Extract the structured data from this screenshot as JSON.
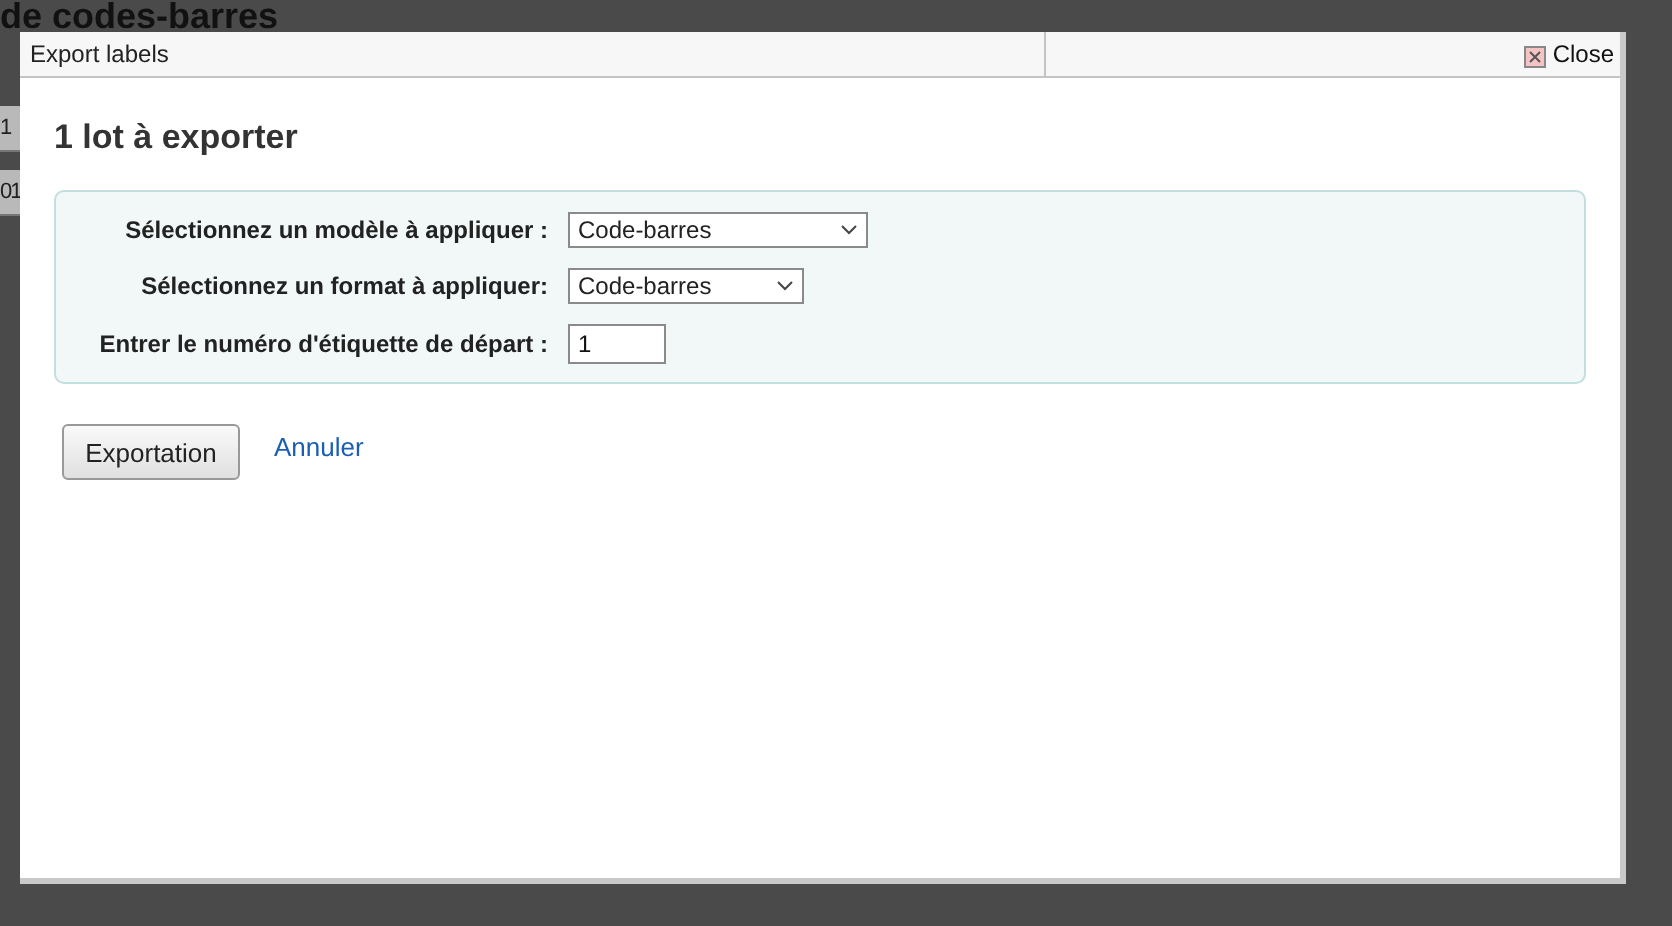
{
  "background": {
    "heading": "de codes-barres",
    "cells": [
      "1",
      "01"
    ]
  },
  "dialog": {
    "title": "Export labels",
    "close": "Close",
    "heading": "1 lot à exporter",
    "fields": [
      {
        "kind": "select",
        "label": "Sélectionnez un modèle à appliquer :",
        "value": "Code-barres"
      },
      {
        "kind": "select",
        "label": "Sélectionnez un format à appliquer:",
        "value": "Code-barres"
      },
      {
        "kind": "input",
        "label": "Entrer le numéro d'étiquette de départ :",
        "value": "1"
      }
    ],
    "button": "Exportation",
    "cancel": "Annuler"
  }
}
